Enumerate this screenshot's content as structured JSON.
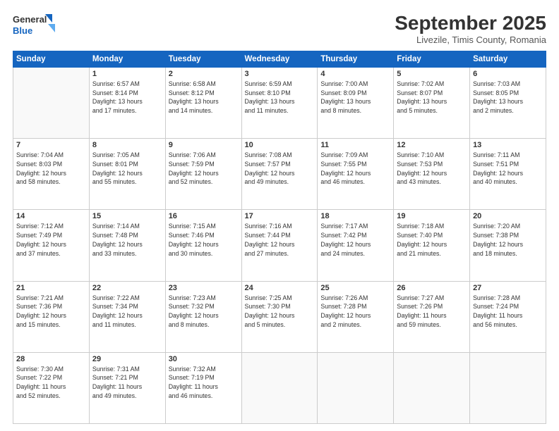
{
  "header": {
    "logo_general": "General",
    "logo_blue": "Blue",
    "month": "September 2025",
    "location": "Livezile, Timis County, Romania"
  },
  "weekdays": [
    "Sunday",
    "Monday",
    "Tuesday",
    "Wednesday",
    "Thursday",
    "Friday",
    "Saturday"
  ],
  "weeks": [
    [
      {
        "day": "",
        "info": ""
      },
      {
        "day": "1",
        "info": "Sunrise: 6:57 AM\nSunset: 8:14 PM\nDaylight: 13 hours\nand 17 minutes."
      },
      {
        "day": "2",
        "info": "Sunrise: 6:58 AM\nSunset: 8:12 PM\nDaylight: 13 hours\nand 14 minutes."
      },
      {
        "day": "3",
        "info": "Sunrise: 6:59 AM\nSunset: 8:10 PM\nDaylight: 13 hours\nand 11 minutes."
      },
      {
        "day": "4",
        "info": "Sunrise: 7:00 AM\nSunset: 8:09 PM\nDaylight: 13 hours\nand 8 minutes."
      },
      {
        "day": "5",
        "info": "Sunrise: 7:02 AM\nSunset: 8:07 PM\nDaylight: 13 hours\nand 5 minutes."
      },
      {
        "day": "6",
        "info": "Sunrise: 7:03 AM\nSunset: 8:05 PM\nDaylight: 13 hours\nand 2 minutes."
      }
    ],
    [
      {
        "day": "7",
        "info": "Sunrise: 7:04 AM\nSunset: 8:03 PM\nDaylight: 12 hours\nand 58 minutes."
      },
      {
        "day": "8",
        "info": "Sunrise: 7:05 AM\nSunset: 8:01 PM\nDaylight: 12 hours\nand 55 minutes."
      },
      {
        "day": "9",
        "info": "Sunrise: 7:06 AM\nSunset: 7:59 PM\nDaylight: 12 hours\nand 52 minutes."
      },
      {
        "day": "10",
        "info": "Sunrise: 7:08 AM\nSunset: 7:57 PM\nDaylight: 12 hours\nand 49 minutes."
      },
      {
        "day": "11",
        "info": "Sunrise: 7:09 AM\nSunset: 7:55 PM\nDaylight: 12 hours\nand 46 minutes."
      },
      {
        "day": "12",
        "info": "Sunrise: 7:10 AM\nSunset: 7:53 PM\nDaylight: 12 hours\nand 43 minutes."
      },
      {
        "day": "13",
        "info": "Sunrise: 7:11 AM\nSunset: 7:51 PM\nDaylight: 12 hours\nand 40 minutes."
      }
    ],
    [
      {
        "day": "14",
        "info": "Sunrise: 7:12 AM\nSunset: 7:49 PM\nDaylight: 12 hours\nand 37 minutes."
      },
      {
        "day": "15",
        "info": "Sunrise: 7:14 AM\nSunset: 7:48 PM\nDaylight: 12 hours\nand 33 minutes."
      },
      {
        "day": "16",
        "info": "Sunrise: 7:15 AM\nSunset: 7:46 PM\nDaylight: 12 hours\nand 30 minutes."
      },
      {
        "day": "17",
        "info": "Sunrise: 7:16 AM\nSunset: 7:44 PM\nDaylight: 12 hours\nand 27 minutes."
      },
      {
        "day": "18",
        "info": "Sunrise: 7:17 AM\nSunset: 7:42 PM\nDaylight: 12 hours\nand 24 minutes."
      },
      {
        "day": "19",
        "info": "Sunrise: 7:18 AM\nSunset: 7:40 PM\nDaylight: 12 hours\nand 21 minutes."
      },
      {
        "day": "20",
        "info": "Sunrise: 7:20 AM\nSunset: 7:38 PM\nDaylight: 12 hours\nand 18 minutes."
      }
    ],
    [
      {
        "day": "21",
        "info": "Sunrise: 7:21 AM\nSunset: 7:36 PM\nDaylight: 12 hours\nand 15 minutes."
      },
      {
        "day": "22",
        "info": "Sunrise: 7:22 AM\nSunset: 7:34 PM\nDaylight: 12 hours\nand 11 minutes."
      },
      {
        "day": "23",
        "info": "Sunrise: 7:23 AM\nSunset: 7:32 PM\nDaylight: 12 hours\nand 8 minutes."
      },
      {
        "day": "24",
        "info": "Sunrise: 7:25 AM\nSunset: 7:30 PM\nDaylight: 12 hours\nand 5 minutes."
      },
      {
        "day": "25",
        "info": "Sunrise: 7:26 AM\nSunset: 7:28 PM\nDaylight: 12 hours\nand 2 minutes."
      },
      {
        "day": "26",
        "info": "Sunrise: 7:27 AM\nSunset: 7:26 PM\nDaylight: 11 hours\nand 59 minutes."
      },
      {
        "day": "27",
        "info": "Sunrise: 7:28 AM\nSunset: 7:24 PM\nDaylight: 11 hours\nand 56 minutes."
      }
    ],
    [
      {
        "day": "28",
        "info": "Sunrise: 7:30 AM\nSunset: 7:22 PM\nDaylight: 11 hours\nand 52 minutes."
      },
      {
        "day": "29",
        "info": "Sunrise: 7:31 AM\nSunset: 7:21 PM\nDaylight: 11 hours\nand 49 minutes."
      },
      {
        "day": "30",
        "info": "Sunrise: 7:32 AM\nSunset: 7:19 PM\nDaylight: 11 hours\nand 46 minutes."
      },
      {
        "day": "",
        "info": ""
      },
      {
        "day": "",
        "info": ""
      },
      {
        "day": "",
        "info": ""
      },
      {
        "day": "",
        "info": ""
      }
    ]
  ]
}
